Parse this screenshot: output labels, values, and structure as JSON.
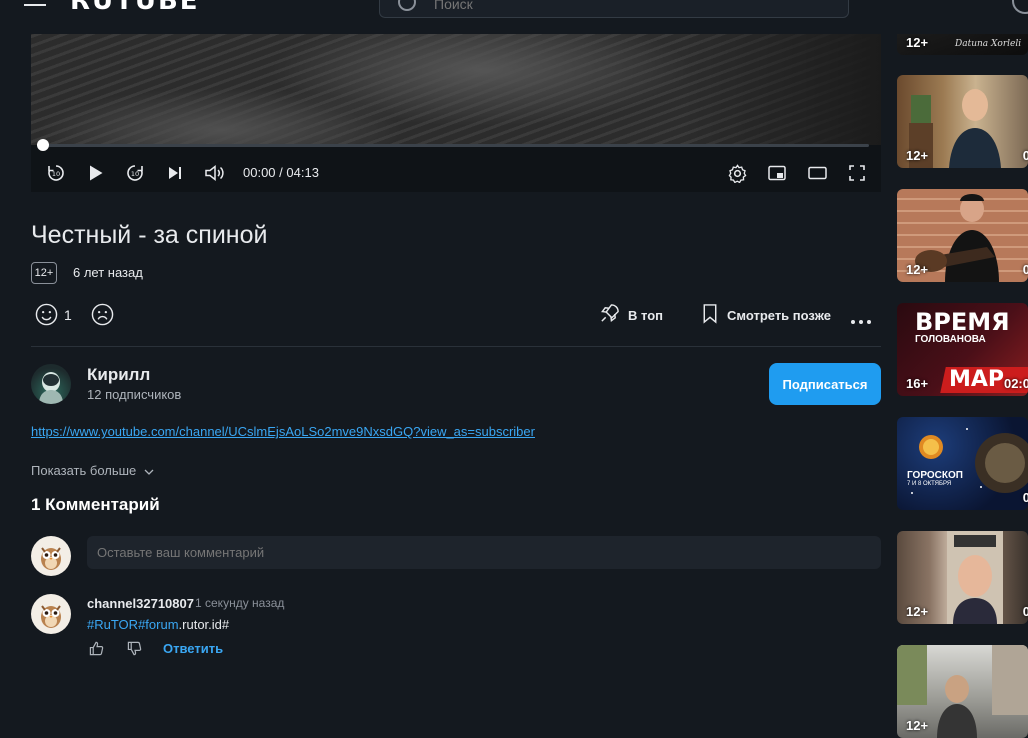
{
  "app": {
    "logo": "RUTUBE"
  },
  "search": {
    "placeholder": "Поиск"
  },
  "player": {
    "time_current": "00:00",
    "time_separator": "/",
    "time_total": "04:13",
    "progress": 0.0
  },
  "video": {
    "title": "Честный - за спиной",
    "age_rating": "12+",
    "published": "6 лет назад",
    "likes": "1"
  },
  "actions": {
    "top_label": "В топ",
    "watch_later_label": "Смотреть позже"
  },
  "channel": {
    "name": "Кирилл",
    "subscribers": "12 подписчиков",
    "subscribe_label": "Подписаться"
  },
  "description": {
    "link": "https://www.youtube.com/channel/UCslmEjsAoLSo2mve9NxsdGQ?view_as=subscriber",
    "show_more": "Показать больше"
  },
  "comments": {
    "title": "1 Комментарий",
    "input_placeholder": "Оставьте ваш комментарий",
    "items": [
      {
        "author": "channel32710807",
        "time": "1 секунду назад",
        "text_tag1": "#RuTOR",
        "text_tag2": "#forum",
        "text_rest": ".rutor.id#",
        "reply_label": "Ответить"
      }
    ]
  },
  "sidebar": {
    "cards": [
      {
        "age": "12+",
        "duration": "",
        "caption": "Datuna Xorleli"
      },
      {
        "age": "12+",
        "duration": "0"
      },
      {
        "age": "12+",
        "duration": "0"
      },
      {
        "age": "16+",
        "duration": "02:0",
        "heading": "ВРЕМЯ",
        "subheading": "ГОЛОВАНОВА",
        "banner": "МАР"
      },
      {
        "age": "",
        "duration": "0",
        "heading": "ГОРОСКОП",
        "subheading": "7 И 8 ОКТЯБРЯ"
      },
      {
        "age": "12+",
        "duration": "0"
      },
      {
        "age": "12+",
        "duration": ""
      }
    ]
  },
  "colors": {
    "accent": "#1f9cf0",
    "link": "#3aa7f3",
    "background": "#14191f"
  }
}
